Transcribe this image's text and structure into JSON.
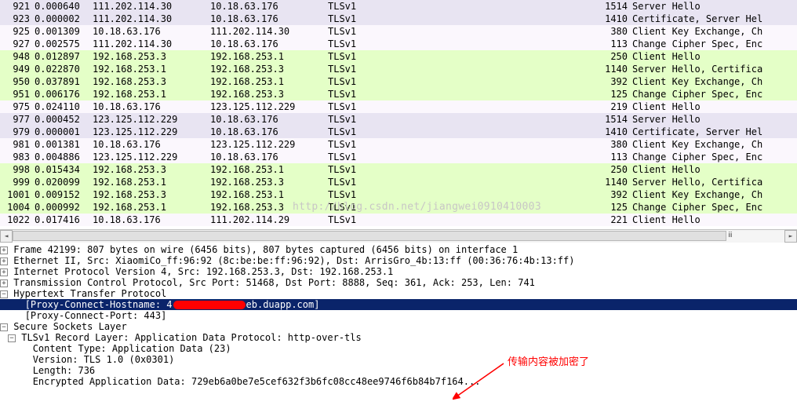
{
  "packets": [
    {
      "no": "921",
      "time": "0.000640",
      "src": "111.202.114.30",
      "dst": "10.18.63.176",
      "proto": "TLSv1",
      "len": "1514",
      "info": "Server Hello",
      "bg": "lav"
    },
    {
      "no": "923",
      "time": "0.000002",
      "src": "111.202.114.30",
      "dst": "10.18.63.176",
      "proto": "TLSv1",
      "len": "1410",
      "info": "Certificate, Server Hel",
      "bg": "lav"
    },
    {
      "no": "925",
      "time": "0.001309",
      "src": "10.18.63.176",
      "dst": "111.202.114.30",
      "proto": "TLSv1",
      "len": "380",
      "info": "Client Key Exchange, Ch",
      "bg": "lav2"
    },
    {
      "no": "927",
      "time": "0.002575",
      "src": "111.202.114.30",
      "dst": "10.18.63.176",
      "proto": "TLSv1",
      "len": "113",
      "info": "Change Cipher Spec, Enc",
      "bg": "lav2"
    },
    {
      "no": "948",
      "time": "0.012897",
      "src": "192.168.253.3",
      "dst": "192.168.253.1",
      "proto": "TLSv1",
      "len": "250",
      "info": "Client Hello",
      "bg": "grn"
    },
    {
      "no": "949",
      "time": "0.022870",
      "src": "192.168.253.1",
      "dst": "192.168.253.3",
      "proto": "TLSv1",
      "len": "1140",
      "info": "Server Hello, Certifica",
      "bg": "grn"
    },
    {
      "no": "950",
      "time": "0.037891",
      "src": "192.168.253.3",
      "dst": "192.168.253.1",
      "proto": "TLSv1",
      "len": "392",
      "info": "Client Key Exchange, Ch",
      "bg": "grn"
    },
    {
      "no": "951",
      "time": "0.006176",
      "src": "192.168.253.1",
      "dst": "192.168.253.3",
      "proto": "TLSv1",
      "len": "125",
      "info": "Change Cipher Spec, Enc",
      "bg": "grn"
    },
    {
      "no": "975",
      "time": "0.024110",
      "src": "10.18.63.176",
      "dst": "123.125.112.229",
      "proto": "TLSv1",
      "len": "219",
      "info": "Client Hello",
      "bg": "lav2"
    },
    {
      "no": "977",
      "time": "0.000452",
      "src": "123.125.112.229",
      "dst": "10.18.63.176",
      "proto": "TLSv1",
      "len": "1514",
      "info": "Server Hello",
      "bg": "lav"
    },
    {
      "no": "979",
      "time": "0.000001",
      "src": "123.125.112.229",
      "dst": "10.18.63.176",
      "proto": "TLSv1",
      "len": "1410",
      "info": "Certificate, Server Hel",
      "bg": "lav"
    },
    {
      "no": "981",
      "time": "0.001381",
      "src": "10.18.63.176",
      "dst": "123.125.112.229",
      "proto": "TLSv1",
      "len": "380",
      "info": "Client Key Exchange, Ch",
      "bg": "lav2"
    },
    {
      "no": "983",
      "time": "0.004886",
      "src": "123.125.112.229",
      "dst": "10.18.63.176",
      "proto": "TLSv1",
      "len": "113",
      "info": "Change Cipher Spec, Enc",
      "bg": "lav2"
    },
    {
      "no": "998",
      "time": "0.015434",
      "src": "192.168.253.3",
      "dst": "192.168.253.1",
      "proto": "TLSv1",
      "len": "250",
      "info": "Client Hello",
      "bg": "grn"
    },
    {
      "no": "999",
      "time": "0.020099",
      "src": "192.168.253.1",
      "dst": "192.168.253.3",
      "proto": "TLSv1",
      "len": "1140",
      "info": "Server Hello, Certifica",
      "bg": "grn"
    },
    {
      "no": "1001",
      "time": "0.009152",
      "src": "192.168.253.3",
      "dst": "192.168.253.1",
      "proto": "TLSv1",
      "len": "392",
      "info": "Client Key Exchange, Ch",
      "bg": "grn"
    },
    {
      "no": "1004",
      "time": "0.000992",
      "src": "192.168.253.1",
      "dst": "192.168.253.3",
      "proto": "TLSv1",
      "len": "125",
      "info": "Change Cipher Spec, Enc",
      "bg": "grn"
    },
    {
      "no": "1022",
      "time": "0.017416",
      "src": "10.18.63.176",
      "dst": "111.202.114.29",
      "proto": "TLSv1",
      "len": "221",
      "info": "Client Hello",
      "bg": "lav2"
    }
  ],
  "watermark": "http://blog.csdn.net/jiangwei0910410003",
  "detail": {
    "frame": "Frame 42199: 807 bytes on wire (6456 bits), 807 bytes captured (6456 bits) on interface 1",
    "eth": "Ethernet II, Src: XiaomiCo_ff:96:92 (8c:be:be:ff:96:92), Dst: ArrisGro_4b:13:ff (00:36:76:4b:13:ff)",
    "ip": "Internet Protocol Version 4, Src: 192.168.253.3, Dst: 192.168.253.1",
    "tcp": "Transmission Control Protocol, Src Port: 51468, Dst Port: 8888, Seq: 361, Ack: 253, Len: 741",
    "http": "Hypertext Transfer Protocol",
    "proxy_host_pre": "[Proxy-Connect-Hostname: 4",
    "proxy_host_suf": "eb.duapp.com]",
    "proxy_port": "[Proxy-Connect-Port: 443]",
    "ssl": "Secure Sockets Layer",
    "tlsrec": "TLSv1 Record Layer: Application Data Protocol: http-over-tls",
    "ctype": "Content Type: Application Data (23)",
    "version": "Version: TLS 1.0 (0x0301)",
    "length": "Length: 736",
    "encdata": "Encrypted Application Data: 729eb6a0be7e5cef632f3b6fc08cc48ee9746f6b84b7f164..."
  },
  "annotation": "传输内容被加密了"
}
